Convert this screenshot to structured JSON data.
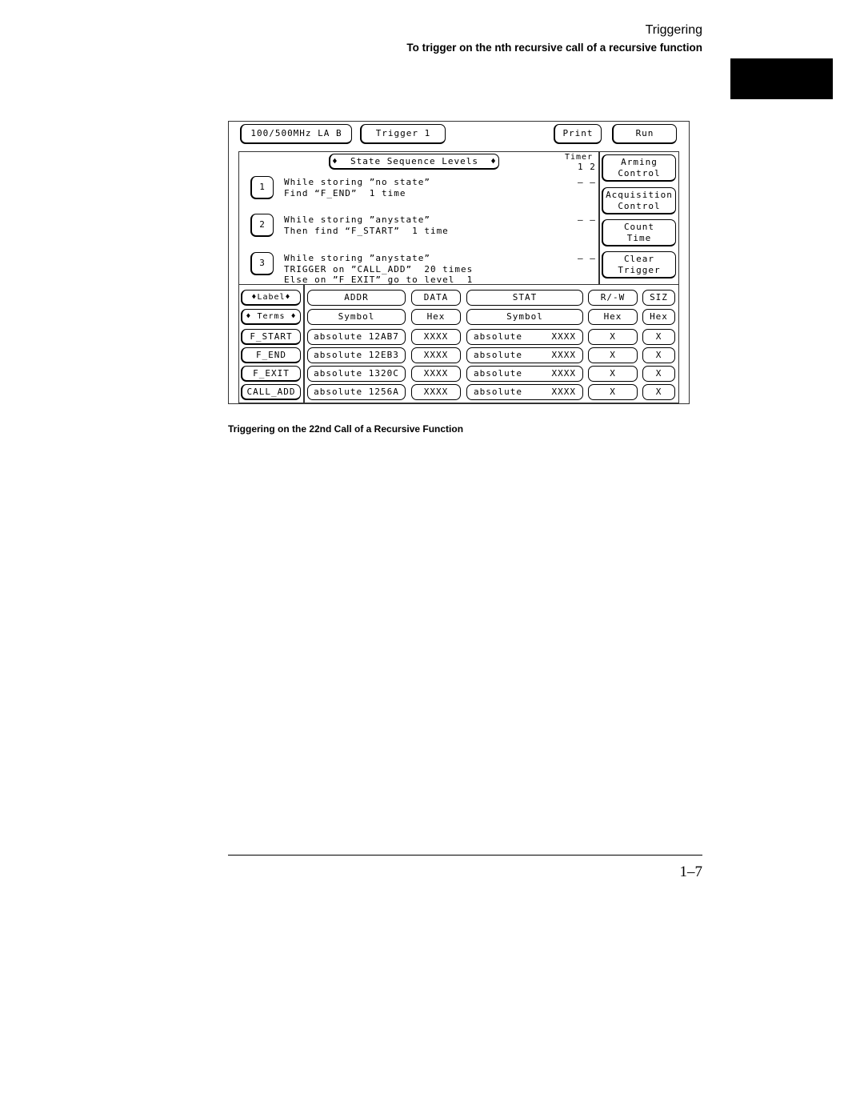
{
  "header": {
    "section": "Triggering",
    "subtitle": "To trigger on the nth recursive call of a recursive function"
  },
  "screen": {
    "top_buttons": {
      "analyzer": "100/500MHz LA B",
      "menu": "Trigger 1",
      "print": "Print",
      "run": "Run"
    },
    "sequence_title": "State Sequence Levels",
    "timer_label": "Timer",
    "timer_cols": "1 2",
    "levels": [
      {
        "number": "1",
        "lines": [
          "While storing ”no state”",
          "Find “F_END”  1 time"
        ],
        "timer": "– –"
      },
      {
        "number": "2",
        "lines": [
          "While storing ”anystate”",
          "Then find “F_START”  1 time"
        ],
        "timer": "– –"
      },
      {
        "number": "3",
        "lines": [
          "While storing ”anystate”",
          "TRIGGER on ”CALL_ADD”  20 times",
          "Else on ”F_EXIT” go to level  1"
        ],
        "timer": "– –"
      }
    ],
    "side_buttons": [
      [
        "Arming",
        "Control"
      ],
      [
        "Acquisition",
        "Control"
      ],
      [
        "Count",
        "Time"
      ],
      [
        "Clear",
        "Trigger"
      ]
    ],
    "label_button": "Label",
    "terms_button": "Terms",
    "columns": [
      "ADDR",
      "DATA",
      "STAT",
      "R/-W",
      "SIZ"
    ],
    "bases": [
      "Symbol",
      "Hex",
      "Symbol",
      "Hex",
      "Hex"
    ],
    "terms": [
      {
        "name": "F_START",
        "addr": "absolute 12AB7",
        "data": "XXXX",
        "stat_mode": "absolute",
        "stat": "XXXX",
        "rw": "X",
        "siz": "X"
      },
      {
        "name": "F_END",
        "addr": "absolute 12EB3",
        "data": "XXXX",
        "stat_mode": "absolute",
        "stat": "XXXX",
        "rw": "X",
        "siz": "X"
      },
      {
        "name": "F_EXIT",
        "addr": "absolute 1320C",
        "data": "XXXX",
        "stat_mode": "absolute",
        "stat": "XXXX",
        "rw": "X",
        "siz": "X"
      },
      {
        "name": "CALL_ADD",
        "addr": "absolute 1256A",
        "data": "XXXX",
        "stat_mode": "absolute",
        "stat": "XXXX",
        "rw": "X",
        "siz": "X"
      }
    ]
  },
  "caption": "Triggering on the 22nd Call of a Recursive Function",
  "page_number": "1–7"
}
